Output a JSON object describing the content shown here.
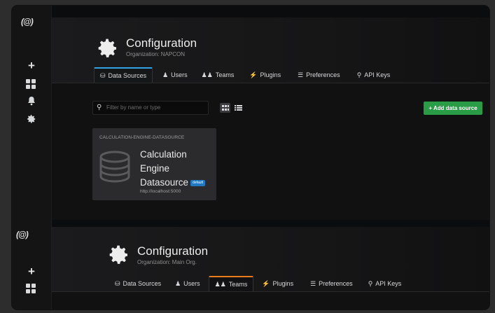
{
  "top": {
    "logo": "(@)",
    "title": "Configuration",
    "subtitle": "Organization: NAPCON",
    "tabs": [
      {
        "label": "Data Sources",
        "icon": "database-icon"
      },
      {
        "label": "Users",
        "icon": "user-icon"
      },
      {
        "label": "Teams",
        "icon": "users-icon"
      },
      {
        "label": "Plugins",
        "icon": "plug-icon"
      },
      {
        "label": "Preferences",
        "icon": "sliders-icon"
      },
      {
        "label": "API Keys",
        "icon": "key-icon"
      }
    ],
    "active_tab": "Data Sources",
    "search_placeholder": "Filter by name or type",
    "add_button": "+ Add data source",
    "card": {
      "type": "CALCULATION-ENGINE-DATASOURCE",
      "name_lines": [
        "Calculation",
        "Engine",
        "Datasource"
      ],
      "badge": "default",
      "url": "http://localhost:5000"
    }
  },
  "bottom": {
    "logo": "(@)",
    "title": "Configuration",
    "subtitle": "Organization: Main Org.",
    "tabs": [
      {
        "label": "Data Sources",
        "icon": "database-icon"
      },
      {
        "label": "Users",
        "icon": "user-icon"
      },
      {
        "label": "Teams",
        "icon": "users-icon"
      },
      {
        "label": "Plugins",
        "icon": "plug-icon"
      },
      {
        "label": "Preferences",
        "icon": "sliders-icon"
      },
      {
        "label": "API Keys",
        "icon": "key-icon"
      }
    ],
    "active_tab": "Teams"
  },
  "colors": {
    "accent_blue": "#33a2e5",
    "accent_orange": "#eb7b18",
    "add_green": "#299c46",
    "badge_blue": "#1f78c1"
  }
}
